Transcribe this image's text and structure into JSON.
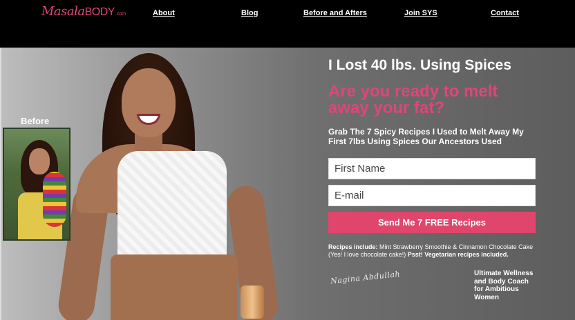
{
  "brand": {
    "logo_script": "Masala",
    "logo_caps": "BODY",
    "logo_domain": ".com",
    "accent_color": "#e0457a"
  },
  "nav": {
    "items": [
      {
        "label": "About"
      },
      {
        "label": "Blog"
      },
      {
        "label": "Before and Afters"
      },
      {
        "label": "Join SYS"
      },
      {
        "label": "Contact"
      }
    ]
  },
  "hero": {
    "before_label": "Before",
    "headline": "I Lost 40 lbs. Using Spices",
    "subhead": "Are you ready to melt away your fat?",
    "grab_text": "Grab The 7 Spicy Recipes I Used to Melt Away My First 7lbs Using Spices Our Ancestors Used",
    "form": {
      "first_name_placeholder": "First Name",
      "email_placeholder": "E-mail",
      "submit_label": "Send Me 7 FREE Recipes",
      "button_color": "#e0456b"
    },
    "recipes_prefix": "Recipes include:",
    "recipes_body": " Mint Strawberry Smoothie & Cinnamon Chocolate Cake (Yes! I love chocolate cake!) ",
    "recipes_veg": "Psst! Vegetarian recipes included.",
    "signature": "Nagina Abdullah",
    "tagline": "Ultimate Wellness and Body Coach for Ambitious Women"
  }
}
